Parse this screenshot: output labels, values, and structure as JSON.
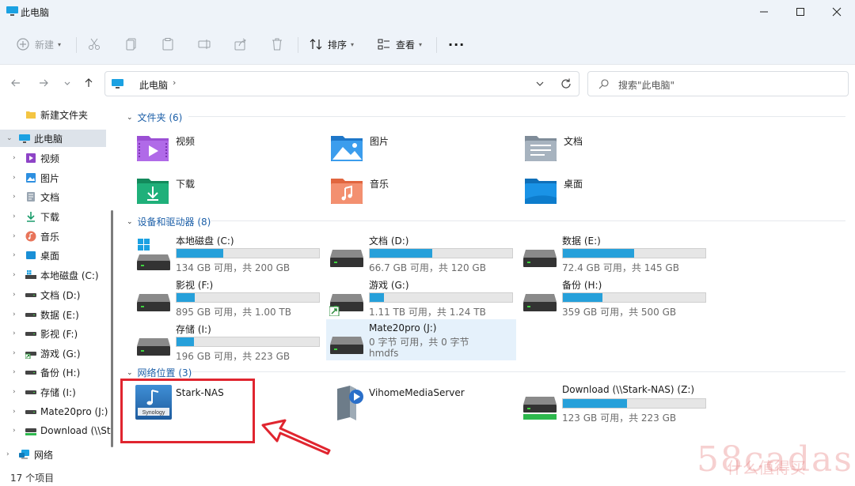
{
  "window": {
    "title": "此电脑",
    "colors": {
      "chrome_bg": "#eef3f9",
      "accent": "#26a0da",
      "link": "#1c5fa8",
      "selection": "#dde3ea",
      "highlight": "#e5f1fb",
      "annotation": "#e0252f"
    }
  },
  "toolbar": {
    "new_label": "新建",
    "sort_label": "排序",
    "view_label": "查看",
    "more_label": "···"
  },
  "address": {
    "crumb": "此电脑",
    "search_placeholder": "搜索\"此电脑\""
  },
  "sidebar": {
    "items": [
      {
        "label": "新建文件夹",
        "icon": "folder-icon"
      },
      {
        "label": "此电脑",
        "icon": "pc-icon"
      },
      {
        "label": "视频",
        "icon": "video-folder-icon"
      },
      {
        "label": "图片",
        "icon": "pictures-folder-icon"
      },
      {
        "label": "文档",
        "icon": "documents-folder-icon"
      },
      {
        "label": "下载",
        "icon": "download-icon"
      },
      {
        "label": "音乐",
        "icon": "music-icon"
      },
      {
        "label": "桌面",
        "icon": "desktop-icon"
      },
      {
        "label": "本地磁盘 (C:)",
        "icon": "drive-icon"
      },
      {
        "label": "文档 (D:)",
        "icon": "drive-icon"
      },
      {
        "label": "数据 (E:)",
        "icon": "drive-icon"
      },
      {
        "label": "影视 (F:)",
        "icon": "drive-icon"
      },
      {
        "label": "游戏 (G:)",
        "icon": "drive-icon"
      },
      {
        "label": "备份 (H:)",
        "icon": "drive-icon"
      },
      {
        "label": "存储 (I:)",
        "icon": "drive-icon"
      },
      {
        "label": "Mate20pro (J:)",
        "icon": "drive-icon"
      },
      {
        "label": "Download (\\\\St",
        "icon": "network-drive-icon"
      },
      {
        "label": "网络",
        "icon": "network-icon"
      }
    ]
  },
  "status": {
    "count": "17 个项目"
  },
  "groups": {
    "folders_header": "文件夹 (6)",
    "drives_header": "设备和驱动器 (8)",
    "network_header": "网络位置 (3)"
  },
  "folders": [
    {
      "name": "视频",
      "icon": "video-folder-icon"
    },
    {
      "name": "图片",
      "icon": "pictures-folder-icon"
    },
    {
      "name": "文档",
      "icon": "documents-folder-icon"
    },
    {
      "name": "下载",
      "icon": "downloads-folder-icon"
    },
    {
      "name": "音乐",
      "icon": "music-folder-icon"
    },
    {
      "name": "桌面",
      "icon": "desktop-folder-icon"
    }
  ],
  "drives": [
    {
      "name": "本地磁盘 (C:)",
      "info": "134 GB 可用，共 200 GB",
      "used": 0.33
    },
    {
      "name": "文档 (D:)",
      "info": "66.7 GB 可用，共 120 GB",
      "used": 0.44
    },
    {
      "name": "数据 (E:)",
      "info": "72.4 GB 可用，共 145 GB",
      "used": 0.5
    },
    {
      "name": "影视 (F:)",
      "info": "895 GB 可用，共 1.00 TB",
      "used": 0.13
    },
    {
      "name": "游戏 (G:)",
      "info": "1.11 TB 可用，共 1.24 TB",
      "used": 0.1
    },
    {
      "name": "备份 (H:)",
      "info": "359 GB 可用，共 500 GB",
      "used": 0.28
    },
    {
      "name": "存储 (I:)",
      "info": "196 GB 可用，共 223 GB",
      "used": 0.12
    },
    {
      "name": "Mate20pro (J:)",
      "info": "0 字节 可用，共 0 字节",
      "sub": "hmdfs"
    }
  ],
  "network": [
    {
      "name": "Stark-NAS",
      "icon": "synology-icon"
    },
    {
      "name": "VihomeMediaServer",
      "icon": "media-server-icon"
    },
    {
      "name": "Download (\\\\Stark-NAS) (Z:)",
      "info": "123 GB 可用，共 223 GB",
      "used": 0.45
    }
  ],
  "watermark": {
    "text": "58cadas",
    "sub": "什么值得买"
  }
}
